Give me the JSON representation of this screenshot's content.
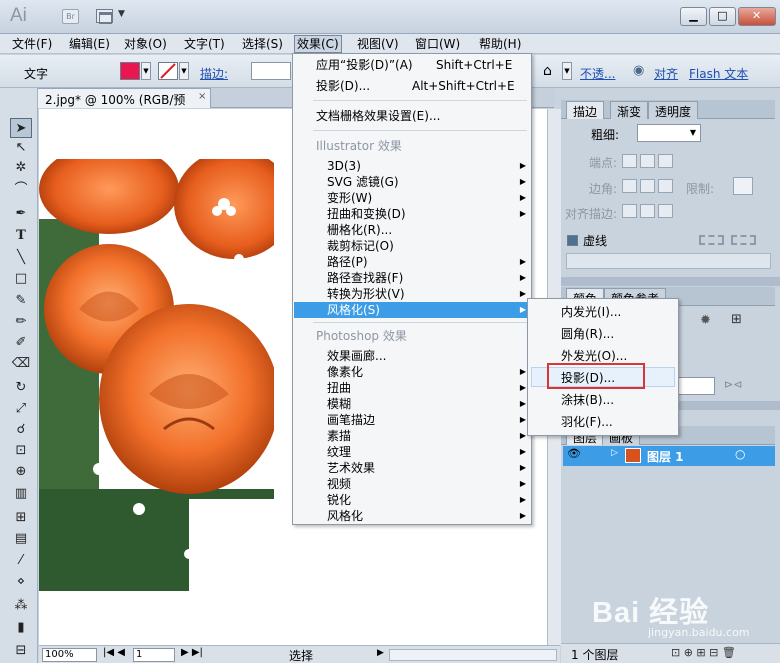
{
  "app": {
    "logo": "Ai",
    "bridge": "Br"
  },
  "window": {
    "min": "▁",
    "max": "□",
    "close": "✕"
  },
  "menubar": [
    "文件(F)",
    "编辑(E)",
    "对象(O)",
    "文字(T)",
    "选择(S)",
    "效果(C)",
    "视图(V)",
    "窗口(W)",
    "帮助(H)"
  ],
  "control": {
    "mode": "文字",
    "fill_color": "#e8174f",
    "stroke_label": "描边:",
    "opacity_link": "不透...",
    "align_link": "对齐",
    "flash_link": "Flash 文本"
  },
  "document": {
    "tab": "2.jpg* @ 100% (RGB/预览)",
    "close": "×"
  },
  "effect_menu": {
    "apply": {
      "label": "应用“投影(D)”(A)",
      "shortcut": "Shift+Ctrl+E"
    },
    "last": {
      "label": "投影(D)...",
      "shortcut": "Alt+Shift+Ctrl+E"
    },
    "raster_settings": "文档栅格效果设置(E)...",
    "illustrator_header": "Illustrator 效果",
    "illustrator_items": [
      "3D(3)",
      "SVG 滤镜(G)",
      "变形(W)",
      "扭曲和变换(D)",
      "栅格化(R)...",
      "裁剪标记(O)",
      "路径(P)",
      "路径查找器(F)",
      "转换为形状(V)",
      "风格化(S)"
    ],
    "photoshop_header": "Photoshop 效果",
    "photoshop_items": [
      "效果画廊...",
      "像素化",
      "扭曲",
      "模糊",
      "画笔描边",
      "素描",
      "纹理",
      "艺术效果",
      "视频",
      "锐化",
      "风格化"
    ]
  },
  "stylize_submenu": [
    "内发光(I)...",
    "圆角(R)...",
    "外发光(O)...",
    "投影(D)...",
    "涂抹(B)...",
    "羽化(F)..."
  ],
  "stroke_panel": {
    "tabs": [
      "描边",
      "渐变",
      "透明度"
    ],
    "weight": "粗细:",
    "cap": "端点:",
    "corner": "边角:",
    "limit": "限制:",
    "align": "对齐描边:",
    "dashed": "虚线"
  },
  "swatch_panel": {
    "tabs": [
      "颜色",
      "颜色参考"
    ]
  },
  "layers_panel": {
    "tabs": [
      "图层",
      "画板"
    ],
    "layer_name": "图层 1",
    "count": "1 个图层"
  },
  "status": {
    "zoom": "100%",
    "page": "1",
    "tool": "选择"
  },
  "watermark": {
    "logo": "Bai 经验",
    "url": "jingyan.baidu.com"
  }
}
